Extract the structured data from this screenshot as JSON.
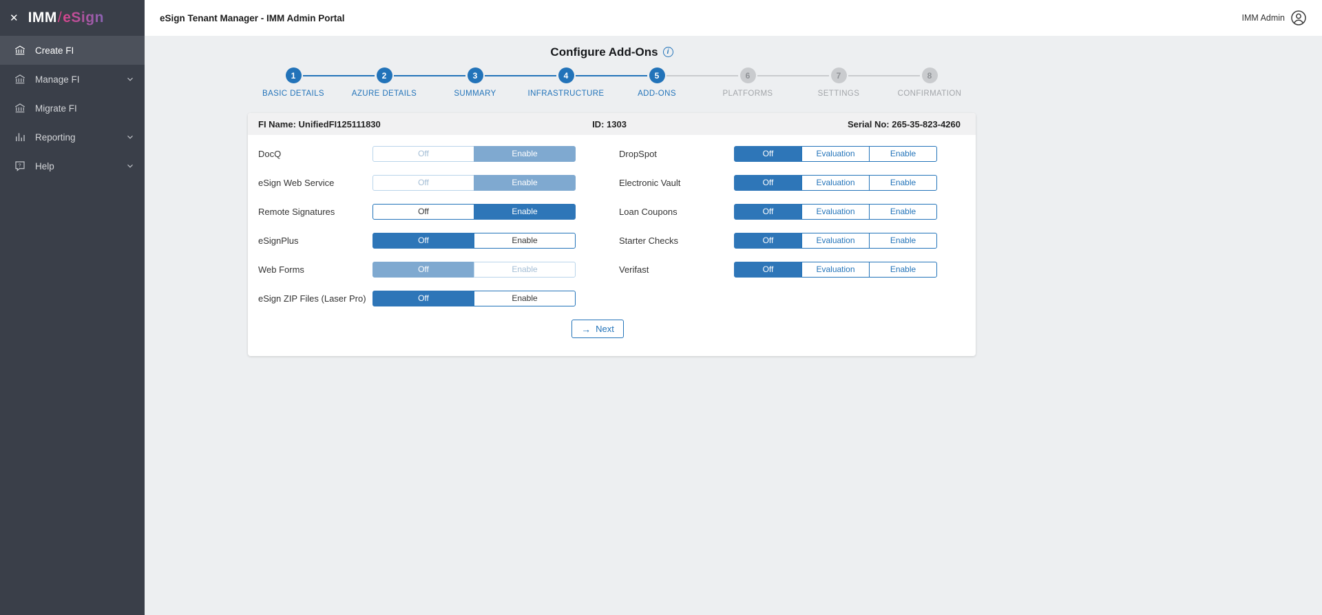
{
  "topbar": {
    "title": "eSign Tenant Manager - IMM Admin Portal",
    "user_label": "IMM Admin"
  },
  "sidebar": {
    "logo": {
      "imm": "IMM",
      "slash": "/",
      "esign": "eSign"
    },
    "items": [
      {
        "label": "Create FI",
        "icon": "bank-icon",
        "active": true,
        "chevron": false
      },
      {
        "label": "Manage FI",
        "icon": "bank-icon",
        "active": false,
        "chevron": true
      },
      {
        "label": "Migrate FI",
        "icon": "bank-icon",
        "active": false,
        "chevron": false
      },
      {
        "label": "Reporting",
        "icon": "bar-chart-icon",
        "active": false,
        "chevron": true
      },
      {
        "label": "Help",
        "icon": "help-icon",
        "active": false,
        "chevron": true
      }
    ]
  },
  "page": {
    "title": "Configure Add-Ons",
    "info_icon": "i"
  },
  "stepper": {
    "steps": [
      {
        "num": "1",
        "label": "BASIC DETAILS",
        "state": "done"
      },
      {
        "num": "2",
        "label": "AZURE DETAILS",
        "state": "done"
      },
      {
        "num": "3",
        "label": "SUMMARY",
        "state": "done"
      },
      {
        "num": "4",
        "label": "INFRASTRUCTURE",
        "state": "done"
      },
      {
        "num": "5",
        "label": "ADD-ONS",
        "state": "active"
      },
      {
        "num": "6",
        "label": "PLATFORMS",
        "state": "pending"
      },
      {
        "num": "7",
        "label": "SETTINGS",
        "state": "pending"
      },
      {
        "num": "8",
        "label": "CONFIRMATION",
        "state": "pending"
      }
    ]
  },
  "card": {
    "fi_name": "FI Name: UnifiedFI125111830",
    "fi_id": "ID: 1303",
    "serial": "Serial No: 265-35-823-4260"
  },
  "addons": {
    "left": [
      {
        "label": "DocQ",
        "options": [
          {
            "label": "Off",
            "state": "disabled-plain"
          },
          {
            "label": "Enable",
            "state": "disabled-selected"
          }
        ]
      },
      {
        "label": "eSign Web Service",
        "options": [
          {
            "label": "Off",
            "state": "disabled-plain"
          },
          {
            "label": "Enable",
            "state": "disabled-selected"
          }
        ]
      },
      {
        "label": "Remote Signatures",
        "options": [
          {
            "label": "Off",
            "state": "plain"
          },
          {
            "label": "Enable",
            "state": "selected"
          }
        ]
      },
      {
        "label": "eSignPlus",
        "options": [
          {
            "label": "Off",
            "state": "selected"
          },
          {
            "label": "Enable",
            "state": "plain"
          }
        ]
      },
      {
        "label": "Web Forms",
        "options": [
          {
            "label": "Off",
            "state": "disabled-selected"
          },
          {
            "label": "Enable",
            "state": "disabled-plain"
          }
        ]
      },
      {
        "label": "eSign ZIP Files (Laser Pro)",
        "options": [
          {
            "label": "Off",
            "state": "selected"
          },
          {
            "label": "Enable",
            "state": "plain"
          }
        ]
      }
    ],
    "right": [
      {
        "label": "DropSpot",
        "options": [
          {
            "label": "Off",
            "state": "selected"
          },
          {
            "label": "Evaluation",
            "state": "plain"
          },
          {
            "label": "Enable",
            "state": "plain"
          }
        ]
      },
      {
        "label": "Electronic Vault",
        "options": [
          {
            "label": "Off",
            "state": "selected"
          },
          {
            "label": "Evaluation",
            "state": "plain"
          },
          {
            "label": "Enable",
            "state": "plain"
          }
        ]
      },
      {
        "label": "Loan Coupons",
        "options": [
          {
            "label": "Off",
            "state": "selected"
          },
          {
            "label": "Evaluation",
            "state": "plain"
          },
          {
            "label": "Enable",
            "state": "plain"
          }
        ]
      },
      {
        "label": "Starter Checks",
        "options": [
          {
            "label": "Off",
            "state": "selected"
          },
          {
            "label": "Evaluation",
            "state": "plain"
          },
          {
            "label": "Enable",
            "state": "plain"
          }
        ]
      },
      {
        "label": "Verifast",
        "options": [
          {
            "label": "Off",
            "state": "selected"
          },
          {
            "label": "Evaluation",
            "state": "plain"
          },
          {
            "label": "Enable",
            "state": "plain"
          }
        ]
      }
    ]
  },
  "actions": {
    "next_label": "Next",
    "next_arrow": "→"
  },
  "colors": {
    "primary_blue": "#2273b9",
    "selected_fill": "#2e76b8",
    "muted_fill": "#7fa9d0",
    "sidebar_bg": "#3a3f49",
    "content_bg": "#edeff1"
  }
}
